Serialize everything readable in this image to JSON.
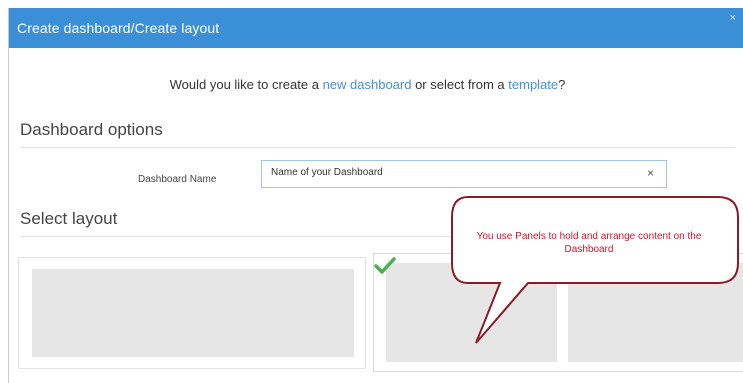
{
  "dialog": {
    "title": "Create dashboard/Create layout",
    "close_label": "×"
  },
  "intro": {
    "prefix": "Would you like to create a ",
    "new_dashboard_link": "new dashboard",
    "middle": " or select from a ",
    "template_link": "template",
    "suffix": "?"
  },
  "dashboard_options": {
    "heading": "Dashboard options",
    "name_label": "Dashboard Name",
    "name_value": "Name of your Dashboard",
    "clear_label": "×"
  },
  "select_layout": {
    "heading": "Select layout",
    "selected_index": 1
  },
  "callout": {
    "text": "You use Panels to hold and arrange content on the Dashboard"
  },
  "colors": {
    "titlebar": "#3a8fd6",
    "link": "#4a8fd4",
    "check": "#4caf50",
    "callout_fill": "#ffffff",
    "callout_border": "#8b1a2a",
    "callout_text": "#d4142a"
  },
  "icons": {
    "check": "checkmark-icon",
    "close": "close-icon",
    "clear": "clear-input-icon"
  }
}
